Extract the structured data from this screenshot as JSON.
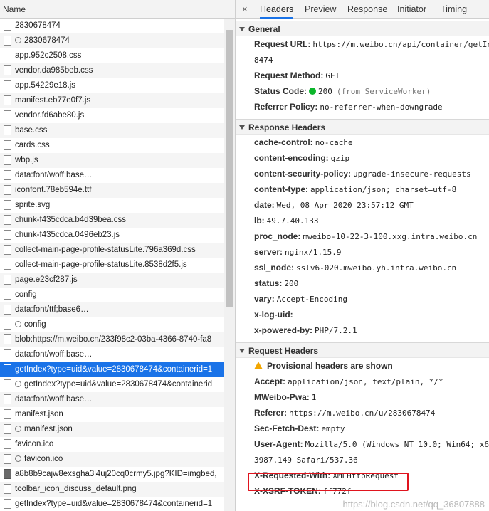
{
  "left": {
    "header": "Name",
    "rows": [
      {
        "text": "2830678474",
        "gear": false,
        "img": false
      },
      {
        "text": "2830678474",
        "gear": true,
        "img": false
      },
      {
        "text": "app.952c2508.css",
        "gear": false,
        "img": false
      },
      {
        "text": "vendor.da985beb.css",
        "gear": false,
        "img": false
      },
      {
        "text": "app.54229e18.js",
        "gear": false,
        "img": false
      },
      {
        "text": "manifest.eb77e0f7.js",
        "gear": false,
        "img": false
      },
      {
        "text": "vendor.fd6abe80.js",
        "gear": false,
        "img": false
      },
      {
        "text": "base.css",
        "gear": false,
        "img": false
      },
      {
        "text": "cards.css",
        "gear": false,
        "img": false
      },
      {
        "text": "wbp.js",
        "gear": false,
        "img": false
      },
      {
        "text": "data:font/woff;base…",
        "gear": false,
        "img": false
      },
      {
        "text": "iconfont.78eb594e.ttf",
        "gear": false,
        "img": false
      },
      {
        "text": "sprite.svg",
        "gear": false,
        "img": false
      },
      {
        "text": "chunk-f435cdca.b4d39bea.css",
        "gear": false,
        "img": false
      },
      {
        "text": "chunk-f435cdca.0496eb23.js",
        "gear": false,
        "img": false
      },
      {
        "text": "collect-main-page-profile-statusLite.796a369d.css",
        "gear": false,
        "img": false
      },
      {
        "text": "collect-main-page-profile-statusLite.8538d2f5.js",
        "gear": false,
        "img": false
      },
      {
        "text": "page.e23cf287.js",
        "gear": false,
        "img": false
      },
      {
        "text": "config",
        "gear": false,
        "img": false
      },
      {
        "text": "data:font/ttf;base6…",
        "gear": false,
        "img": false
      },
      {
        "text": "config",
        "gear": true,
        "img": false
      },
      {
        "text": "blob:https://m.weibo.cn/233f98c2-03ba-4366-8740-fa8",
        "gear": false,
        "img": false
      },
      {
        "text": "data:font/woff;base…",
        "gear": false,
        "img": false
      },
      {
        "text": "getIndex?type=uid&value=2830678474&containerid=1",
        "gear": false,
        "img": false,
        "selected": true
      },
      {
        "text": "getIndex?type=uid&value=2830678474&containerid",
        "gear": true,
        "img": false
      },
      {
        "text": "data:font/woff;base…",
        "gear": false,
        "img": false
      },
      {
        "text": "manifest.json",
        "gear": false,
        "img": false
      },
      {
        "text": "manifest.json",
        "gear": true,
        "img": false
      },
      {
        "text": "favicon.ico",
        "gear": false,
        "img": false
      },
      {
        "text": "favicon.ico",
        "gear": true,
        "img": false
      },
      {
        "text": "a8b8b9cajw8exsgha3l4uj20cq0crmy5.jpg?KID=imgbed,",
        "gear": false,
        "img": true
      },
      {
        "text": "toolbar_icon_discuss_default.png",
        "gear": false,
        "img": false
      },
      {
        "text": "getIndex?type=uid&value=2830678474&containerid=1",
        "gear": false,
        "img": false
      }
    ]
  },
  "tabs": {
    "close": "×",
    "items": [
      "Headers",
      "Preview",
      "Response",
      "Initiator",
      "Timing"
    ]
  },
  "general": {
    "title": "General",
    "request_url_label": "Request URL:",
    "request_url_value": "https://m.weibo.cn/api/container/getIn",
    "request_url_cont": "8474",
    "method_label": "Request Method:",
    "method_value": "GET",
    "status_label": "Status Code:",
    "status_value": "200",
    "status_note": "(from ServiceWorker)",
    "status_color": "#0bb62b",
    "referrer_label": "Referrer Policy:",
    "referrer_value": "no-referrer-when-downgrade"
  },
  "response_headers": {
    "title": "Response Headers",
    "items": [
      {
        "k": "cache-control:",
        "v": "no-cache"
      },
      {
        "k": "content-encoding:",
        "v": "gzip"
      },
      {
        "k": "content-security-policy:",
        "v": "upgrade-insecure-requests"
      },
      {
        "k": "content-type:",
        "v": "application/json; charset=utf-8"
      },
      {
        "k": "date:",
        "v": "Wed, 08 Apr 2020 23:57:12 GMT"
      },
      {
        "k": "lb:",
        "v": "49.7.40.133"
      },
      {
        "k": "proc_node:",
        "v": "mweibo-10-22-3-100.xxg.intra.weibo.cn"
      },
      {
        "k": "server:",
        "v": "nginx/1.15.9"
      },
      {
        "k": "ssl_node:",
        "v": "sslv6-020.mweibo.yh.intra.weibo.cn"
      },
      {
        "k": "status:",
        "v": "200"
      },
      {
        "k": "vary:",
        "v": "Accept-Encoding"
      },
      {
        "k": "x-log-uid:",
        "v": ""
      },
      {
        "k": "x-powered-by:",
        "v": "PHP/7.2.1"
      }
    ]
  },
  "request_headers": {
    "title": "Request Headers",
    "provisional": "Provisional headers are shown",
    "accept_label": "Accept:",
    "accept_value": "application/json, text/plain, */*",
    "pwa_label": "MWeibo-Pwa:",
    "pwa_value": "1",
    "referer_label": "Referer:",
    "referer_value": "https://m.weibo.cn/u/2830678474",
    "fetch_label": "Sec-Fetch-Dest:",
    "fetch_value": "empty",
    "ua_label": "User-Agent:",
    "ua_value": "Mozilla/5.0 (Windows NT 10.0; Win64; x6",
    "ua_cont": "3987.149 Safari/537.36",
    "xrw_label": "X-Requested-With:",
    "xrw_value": "XMLHttpRequest",
    "xsrf_label": "X-XSRF-TOKEN:",
    "xsrf_value": "ff772f"
  },
  "watermark": "https://blog.csdn.net/qq_36807888",
  "accent": "#1a73e8",
  "highlight_color": "#e0141e"
}
